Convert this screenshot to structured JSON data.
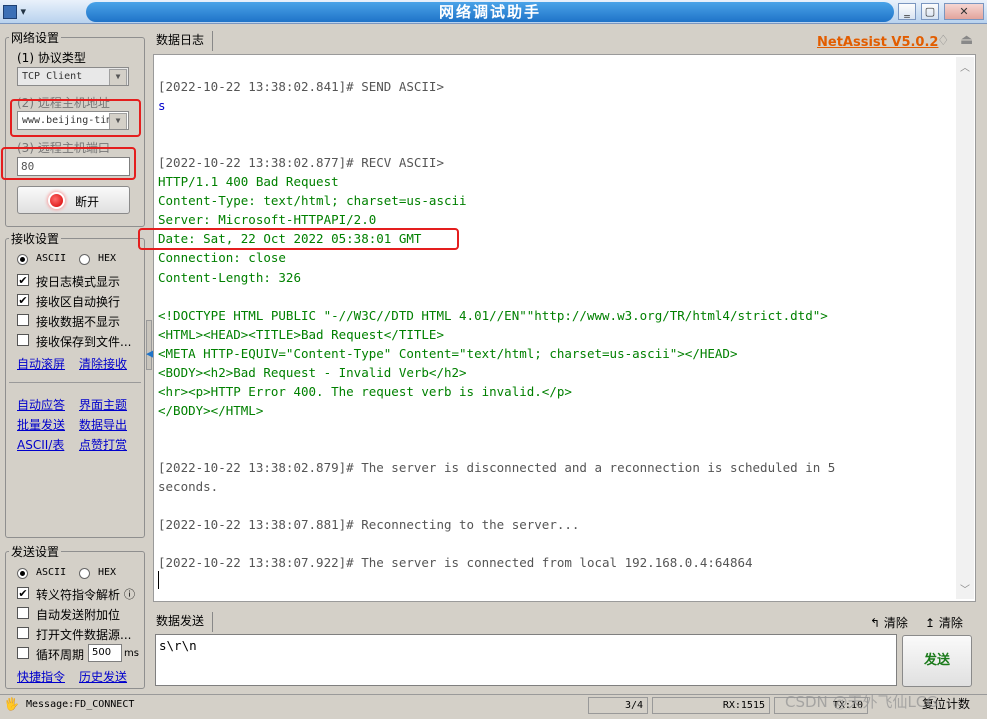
{
  "window": {
    "title": "网络调试助手",
    "app_menu": "▾"
  },
  "header": {
    "log_tab": "数据日志",
    "brand": "NetAssist V5.0.2"
  },
  "network_settings": {
    "title": "网络设置",
    "protocol_label": "(1) 协议类型",
    "protocol_value": "TCP Client",
    "host_label": "(2) 远程主机地址",
    "host_value": "www.beijing-tim",
    "port_label": "(3) 远程主机端口",
    "port_value": "80",
    "disconnect_label": "断开"
  },
  "receive_settings": {
    "title": "接收设置",
    "ascii": "ASCII",
    "hex": "HEX",
    "options": [
      "按日志模式显示",
      "接收区自动换行",
      "接收数据不显示",
      "接收保存到文件..."
    ],
    "options_checked": [
      true,
      true,
      false,
      false
    ],
    "auto_scroll": "自动滚屏",
    "clear_recv": "清除接收"
  },
  "tools": {
    "auto_reply": "自动应答",
    "theme": "界面主题",
    "batch_send": "批量发送",
    "export": "数据导出",
    "ascii_table": "ASCII/表",
    "tip": "点赞打赏"
  },
  "send_settings": {
    "title": "发送设置",
    "ascii": "ASCII",
    "hex": "HEX",
    "options": [
      "转义符指令解析",
      "自动发送附加位",
      "打开文件数据源...",
      "循环周期"
    ],
    "options_checked": [
      true,
      false,
      false,
      false
    ],
    "info_icon": "ⓘ",
    "period_value": "500",
    "period_unit": "ms",
    "shortcut": "快捷指令",
    "history": "历史发送"
  },
  "log": [
    {
      "text": "[2022-10-22 13:38:02.841]# SEND ASCII>",
      "style": "sys"
    },
    {
      "text": "s",
      "style": "blue"
    },
    {
      "text": "",
      "style": "sys"
    },
    {
      "text": "",
      "style": "sys"
    },
    {
      "text": "[2022-10-22 13:38:02.877]# RECV ASCII>",
      "style": "sys"
    },
    {
      "text": "HTTP/1.1 400 Bad Request",
      "style": "recv"
    },
    {
      "text": "Content-Type: text/html; charset=us-ascii",
      "style": "recv"
    },
    {
      "text": "Server: Microsoft-HTTPAPI/2.0",
      "style": "recv"
    },
    {
      "text": "Date: Sat, 22 Oct 2022 05:38:01 GMT",
      "style": "recv"
    },
    {
      "text": "Connection: close",
      "style": "recv"
    },
    {
      "text": "Content-Length: 326",
      "style": "recv"
    },
    {
      "text": "",
      "style": "sys"
    },
    {
      "text": "<!DOCTYPE HTML PUBLIC \"-//W3C//DTD HTML 4.01//EN\"\"http://www.w3.org/TR/html4/strict.dtd\">",
      "style": "recv"
    },
    {
      "text": "<HTML><HEAD><TITLE>Bad Request</TITLE>",
      "style": "recv"
    },
    {
      "text": "<META HTTP-EQUIV=\"Content-Type\" Content=\"text/html; charset=us-ascii\"></HEAD>",
      "style": "recv"
    },
    {
      "text": "<BODY><h2>Bad Request - Invalid Verb</h2>",
      "style": "recv"
    },
    {
      "text": "<hr><p>HTTP Error 400. The request verb is invalid.</p>",
      "style": "recv"
    },
    {
      "text": "</BODY></HTML>",
      "style": "recv"
    },
    {
      "text": "",
      "style": "sys"
    },
    {
      "text": "",
      "style": "sys"
    },
    {
      "text": "[2022-10-22 13:38:02.879]# The server is disconnected and a reconnection is scheduled in 5",
      "style": "sys"
    },
    {
      "text": "seconds.",
      "style": "sys"
    },
    {
      "text": "",
      "style": "sys"
    },
    {
      "text": "[2022-10-22 13:38:07.881]# Reconnecting to the server...",
      "style": "sys"
    },
    {
      "text": "",
      "style": "sys"
    },
    {
      "text": "[2022-10-22 13:38:07.922]# The server is connected from local 192.168.0.4:64864",
      "style": "sys"
    }
  ],
  "send_area": {
    "tab": "数据发送",
    "clear1": "清除",
    "clear2": "清除",
    "input_value": "s\\r\\n",
    "send_button": "发送"
  },
  "status_bar": {
    "message": "Message:FD_CONNECT",
    "page": "3/4",
    "rx": "RX:1515",
    "tx": "TX:10",
    "reset": "复位计数",
    "watermark": "CSDN @天外飞仙LCG"
  },
  "colors": {
    "accent": "#1f73c8",
    "highlight": "#e41e1e",
    "recv_text": "#008000",
    "brand": "#e25d00"
  }
}
